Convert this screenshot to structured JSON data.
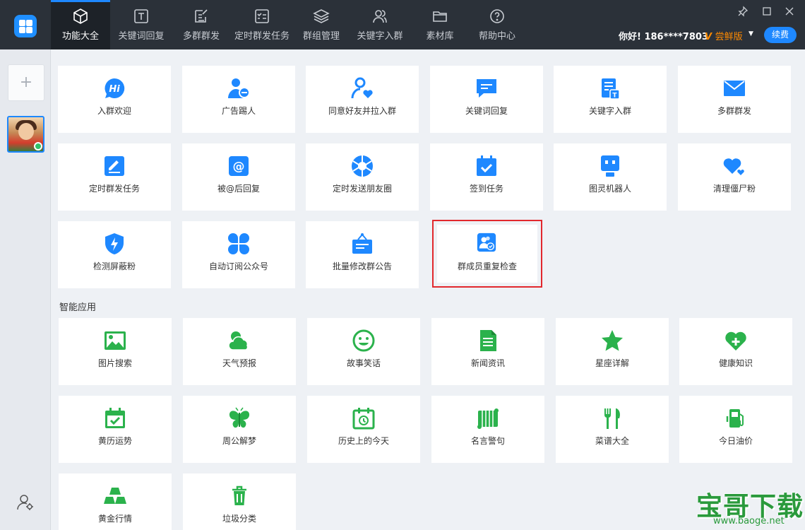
{
  "colors": {
    "blue": "#1e88ff",
    "green": "#2bb24c",
    "topbar": "#2b3139",
    "highlight": "#e2282d",
    "version": "#ff8a00"
  },
  "nav": {
    "items": [
      {
        "label": "功能大全",
        "icon": "cube-icon",
        "active": true
      },
      {
        "label": "关键词回复",
        "icon": "text-t-icon"
      },
      {
        "label": "多群群发",
        "icon": "edit-doc-icon"
      },
      {
        "label": "定时群发任务",
        "icon": "checklist-icon"
      },
      {
        "label": "群组管理",
        "icon": "layers-icon"
      },
      {
        "label": "关键字入群",
        "icon": "users-icon"
      },
      {
        "label": "素材库",
        "icon": "folder-icon"
      },
      {
        "label": "帮助中心",
        "icon": "help-icon"
      }
    ]
  },
  "user": {
    "greeting": "你好! 186****7803",
    "version": "尝鲜版",
    "renew": "续费"
  },
  "sidebar": {
    "add": "+"
  },
  "features": [
    {
      "label": "入群欢迎",
      "icon": "hi-bubble-icon"
    },
    {
      "label": "广告踢人",
      "icon": "user-minus-icon"
    },
    {
      "label": "同意好友并拉入群",
      "icon": "user-heart-icon"
    },
    {
      "label": "关键词回复",
      "icon": "chat-bubble-icon"
    },
    {
      "label": "关键字入群",
      "icon": "doc-t-icon"
    },
    {
      "label": "多群群发",
      "icon": "envelope-icon"
    },
    {
      "label": "定时群发任务",
      "icon": "pencil-box-icon"
    },
    {
      "label": "被@后回复",
      "icon": "at-icon"
    },
    {
      "label": "定时发送朋友圈",
      "icon": "aperture-icon"
    },
    {
      "label": "签到任务",
      "icon": "calendar-check-icon"
    },
    {
      "label": "图灵机器人",
      "icon": "robot-icon"
    },
    {
      "label": "清理僵尸粉",
      "icon": "hearts-icon"
    },
    {
      "label": "检测屏蔽粉",
      "icon": "shield-bolt-icon"
    },
    {
      "label": "自动订阅公众号",
      "icon": "clover-icon"
    },
    {
      "label": "批量修改群公告",
      "icon": "notice-board-icon"
    },
    {
      "label": "群成员重复检查",
      "icon": "member-check-icon",
      "highlighted": true
    }
  ],
  "smart_section_title": "智能应用",
  "smart": [
    {
      "label": "图片搜索",
      "icon": "image-icon"
    },
    {
      "label": "天气预报",
      "icon": "weather-icon"
    },
    {
      "label": "故事笑话",
      "icon": "smiley-icon"
    },
    {
      "label": "新闻资讯",
      "icon": "news-doc-icon"
    },
    {
      "label": "星座详解",
      "icon": "star-icon"
    },
    {
      "label": "健康知识",
      "icon": "heart-plus-icon"
    },
    {
      "label": "黄历运势",
      "icon": "calendar-icon"
    },
    {
      "label": "周公解梦",
      "icon": "butterfly-icon"
    },
    {
      "label": "历史上的今天",
      "icon": "history-calendar-icon"
    },
    {
      "label": "名言警句",
      "icon": "scroll-icon"
    },
    {
      "label": "菜谱大全",
      "icon": "fork-knife-icon"
    },
    {
      "label": "今日油价",
      "icon": "fuel-pump-icon"
    },
    {
      "label": "黄金行情",
      "icon": "gold-bars-icon"
    },
    {
      "label": "垃圾分类",
      "icon": "trash-icon"
    }
  ],
  "watermark": {
    "title": "宝哥下载",
    "url": "www.baoge.net"
  }
}
